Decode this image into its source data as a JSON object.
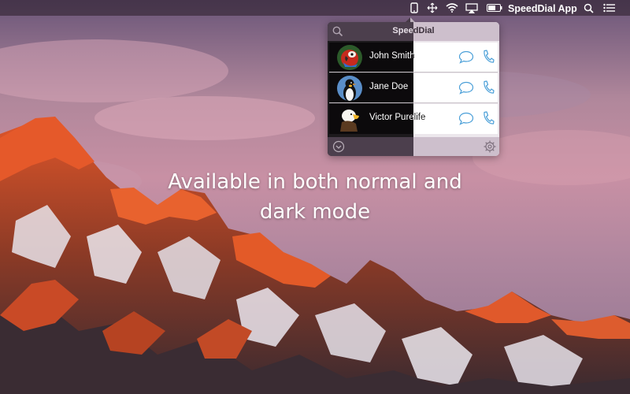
{
  "menubar": {
    "app_title": "SpeedDial App",
    "icons": [
      "speeddial-menubar-icon",
      "cursor-move-icon",
      "wifi-icon",
      "airplay-icon",
      "battery-icon",
      "spotlight-search-icon",
      "notification-list-icon"
    ]
  },
  "popover": {
    "title": "SpeedDial",
    "contacts": [
      {
        "name": "John Smith",
        "avatar": "parrot"
      },
      {
        "name": "Jane Doe",
        "avatar": "penguin"
      },
      {
        "name": "Victor Purelife",
        "avatar": "eagle"
      }
    ]
  },
  "promo": {
    "line1": "Available in both normal and",
    "line2": "dark mode"
  },
  "colors": {
    "accent_blue": "#4a9fd8",
    "dark_bg": "#0c0a0c",
    "light_bg": "#ffffff",
    "header_dark": "#4c3f4d",
    "header_light": "#cdbfcc"
  }
}
